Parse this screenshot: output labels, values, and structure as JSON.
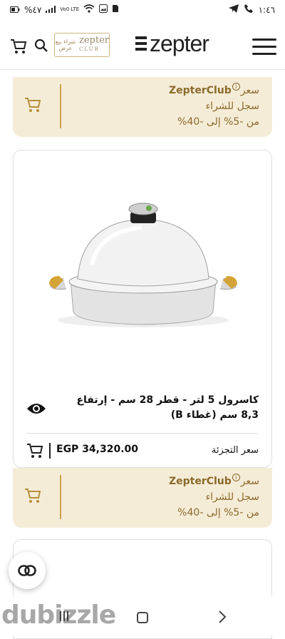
{
  "status_bar": {
    "time": "١:٤٦",
    "battery": "%٤٧",
    "network": "Vo0 LTE"
  },
  "header": {
    "brand": "zepter",
    "club_badge_ar": "شراء بيع عرض",
    "club_badge_en": "zepter",
    "club_badge_sub": "CLUB",
    "cart_icon": "cart-icon",
    "search_icon": "search-icon",
    "menu_icon": "hamburger-menu-icon"
  },
  "promo_top": {
    "title_brand": "ZepterClub",
    "title_suffix": "سعر",
    "line2": "سجل للشراء",
    "line3": "من -5% إلى -40%"
  },
  "product": {
    "title": "كاسرول 5 لتر - قطر 28 سم - إرتفاع 8,3 سم (غطاء B)",
    "price": "EGP 34,320.00",
    "price_label": "سعر التجزئة"
  },
  "promo_bottom": {
    "title_brand": "ZepterClub",
    "title_suffix": "سعر",
    "line2": "سجل للشراء",
    "line3": "من -5% إلى -40%"
  },
  "watermark": "dubizzle",
  "colors": {
    "promo_bg": "#f5ecd7",
    "promo_text": "#8a6a2c",
    "accent_gold": "#c8a24e"
  }
}
